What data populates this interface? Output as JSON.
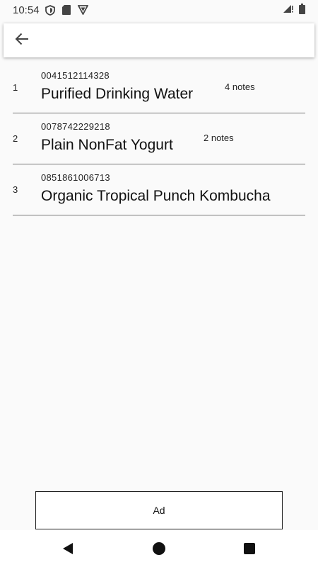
{
  "status_bar": {
    "time": "10:54"
  },
  "search": {
    "value": ""
  },
  "items": [
    {
      "index": "1",
      "code": "0041512114328",
      "name": "Purified Drinking Water",
      "notes": "4 notes"
    },
    {
      "index": "2",
      "code": "0078742229218",
      "name": "Plain NonFat Yogurt",
      "notes": "2 notes"
    },
    {
      "index": "3",
      "code": "0851861006713",
      "name": "Organic Tropical Punch Kombucha",
      "notes": ""
    }
  ],
  "ad": {
    "label": "Ad"
  },
  "icons": {
    "back": "arrow-left-icon",
    "nav_back": "triangle-back-icon",
    "nav_home": "circle-home-icon",
    "nav_recents": "square-recents-icon"
  }
}
